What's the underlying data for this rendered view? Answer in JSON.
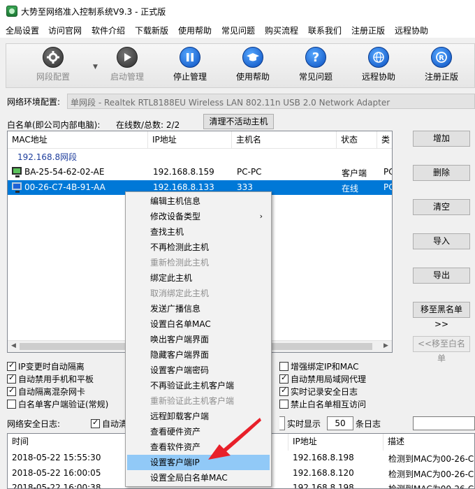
{
  "window": {
    "title": "大势至网络准入控制系统V9.3 - 正式版"
  },
  "menubar": [
    "全局设置",
    "访问官网",
    "软件介绍",
    "下载新版",
    "使用帮助",
    "常见问题",
    "购买流程",
    "联系我们",
    "注册正版",
    "远程协助"
  ],
  "toolbar": [
    {
      "label": "网段配置",
      "icon": "gear-icon",
      "disabled": true
    },
    {
      "label": "启动管理",
      "icon": "play-icon",
      "disabled": true
    },
    {
      "label": "停止管理",
      "icon": "pause-icon",
      "disabled": false
    },
    {
      "label": "使用帮助",
      "icon": "graduation-cap-icon",
      "disabled": false
    },
    {
      "label": "常见问题",
      "icon": "question-icon",
      "disabled": false
    },
    {
      "label": "远程协助",
      "icon": "globe-icon",
      "disabled": false
    },
    {
      "label": "注册正版",
      "icon": "registered-icon",
      "disabled": false
    }
  ],
  "network": {
    "label": "网络环境配置:",
    "value": "单网段 - Realtek RTL8188EU Wireless LAN 802.11n USB 2.0 Network Adapter"
  },
  "whitelist": {
    "label": "白名单(即公司内部电脑):",
    "count_text": "在线数/总数: 2/2",
    "clear_button": "清理不活动主机",
    "columns": [
      "MAC地址",
      "IP地址",
      "主机名",
      "状态",
      "类"
    ],
    "group": "192.168.8网段",
    "rows": [
      {
        "mac": "BA-25-54-62-02-AE",
        "ip": "192.168.8.159",
        "host": "PC-PC",
        "status": "客户端",
        "type": "PC"
      },
      {
        "mac": "00-26-C7-4B-91-AA",
        "ip": "192.168.8.133",
        "host": "333",
        "status": "在线",
        "type": "PC"
      }
    ]
  },
  "side_buttons": [
    "增加",
    "删除",
    "清空",
    "导入",
    "导出",
    "移至黑名单>>",
    "<<移至白名单"
  ],
  "checkboxes_left": [
    {
      "label": "IP变更时自动隔离",
      "checked": true
    },
    {
      "label": "自动禁用手机和平板",
      "checked": true
    },
    {
      "label": "自动隔离混杂网卡",
      "checked": true
    },
    {
      "label": "白名单客户端验证(常规)",
      "checked": false
    }
  ],
  "checkboxes_right": [
    {
      "label": "增强绑定IP和MAC",
      "checked": false
    },
    {
      "label": "自动禁用局域网代理",
      "checked": true
    },
    {
      "label": "实时记录安全日志",
      "checked": true
    },
    {
      "label": "禁止白名单相互访问",
      "checked": false
    }
  ],
  "log": {
    "label": "网络安全日志:",
    "auto_clear": "自动清",
    "show_label": "实时显示",
    "count": "50",
    "unit": "条日志",
    "columns": [
      "时间",
      "IP地址",
      "描述"
    ],
    "rows": [
      {
        "time": "2018-05-22 15:55:30",
        "ip": "192.168.8.198",
        "desc": "检测到MAC为00-26-C"
      },
      {
        "time": "2018-05-22 16:00:05",
        "ip": "192.168.8.120",
        "desc": "检测到MAC为00-26-C"
      },
      {
        "time": "2018-05-22 16:00:38",
        "ip": "192.168.8.198",
        "desc": "检测到MAC为00-26-C"
      }
    ]
  },
  "context_menu": [
    {
      "label": "编辑主机信息",
      "disabled": false
    },
    {
      "label": "修改设备类型",
      "disabled": false,
      "submenu": true
    },
    {
      "label": "查找主机",
      "disabled": false
    },
    {
      "label": "不再检测此主机",
      "disabled": false
    },
    {
      "label": "重新检测此主机",
      "disabled": true
    },
    {
      "label": "绑定此主机",
      "disabled": false
    },
    {
      "label": "取消绑定此主机",
      "disabled": true
    },
    {
      "label": "发送广播信息",
      "disabled": false
    },
    {
      "label": "设置白名单MAC",
      "disabled": false
    },
    {
      "label": "唤出客户端界面",
      "disabled": false
    },
    {
      "label": "隐藏客户端界面",
      "disabled": false
    },
    {
      "label": "设置客户端密码",
      "disabled": false
    },
    {
      "label": "不再验证此主机客户端",
      "disabled": false
    },
    {
      "label": "重新验证此主机客户端",
      "disabled": true
    },
    {
      "label": "远程卸载客户端",
      "disabled": false
    },
    {
      "label": "查看硬件资产",
      "disabled": false
    },
    {
      "label": "查看软件资产",
      "disabled": false
    },
    {
      "label": "设置客户端IP",
      "disabled": false,
      "highlighted": true
    },
    {
      "label": "设置全局白名单MAC",
      "disabled": false
    }
  ],
  "colors": {
    "selection": "#0078d7",
    "menu_hover": "#91c9f7",
    "annotation_arrow": "#e8202a"
  }
}
